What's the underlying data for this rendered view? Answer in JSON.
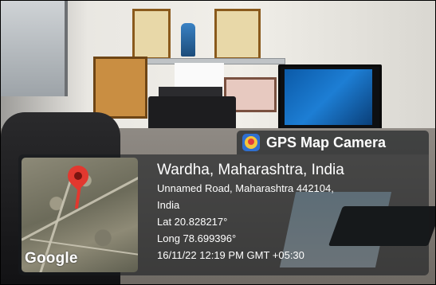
{
  "header": {
    "app_name": "GPS Map Camera",
    "icon": "gps-map-camera-icon"
  },
  "map": {
    "brand": "Google",
    "marker": "map-pin-icon"
  },
  "location": {
    "title": "Wardha, Maharashtra, India",
    "address_line1": "Unnamed Road, Maharashtra 442104,",
    "address_line2": "India",
    "latitude": "Lat 20.828217°",
    "longitude": "Long 78.699396°",
    "datetime": "16/11/22 12:19 PM GMT +05:30"
  },
  "colors": {
    "overlay": "#161a1e",
    "pin": "#e2382f",
    "text": "#ffffff"
  }
}
